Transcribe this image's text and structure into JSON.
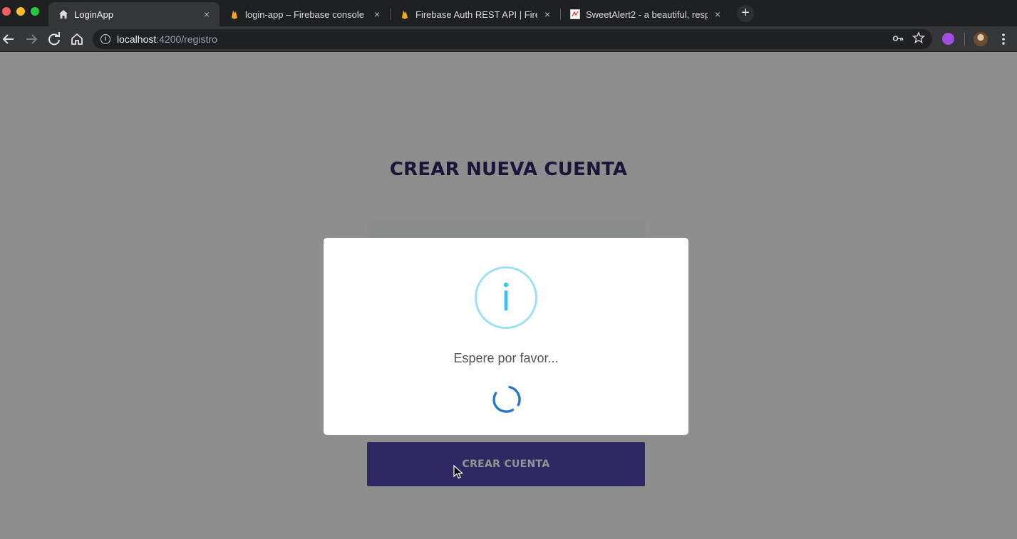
{
  "browser": {
    "tabs": [
      {
        "title": "LoginApp",
        "icon": "home-icon",
        "active": true
      },
      {
        "title": "login-app – Firebase console",
        "icon": "firebase-icon",
        "active": false
      },
      {
        "title": "Firebase Auth REST API  |  Fire",
        "icon": "firebase-icon",
        "active": false
      },
      {
        "title": "SweetAlert2 - a beautiful, resp",
        "icon": "sweetalert-icon",
        "active": false
      }
    ],
    "new_tab_label": "+",
    "close_label": "×",
    "url_host": "localhost",
    "url_path": ":4200/registro"
  },
  "page": {
    "title": "CREAR NUEVA CUENTA",
    "submit_label": "CREAR CUENTA"
  },
  "modal": {
    "icon": "info-icon",
    "message": "Espere por favor..."
  },
  "colors": {
    "title": "#2b2660",
    "button": "#5048a8",
    "info_ring": "#9de0f6",
    "info_glyph": "#3fc3ee",
    "spinner": "#2778c4"
  }
}
